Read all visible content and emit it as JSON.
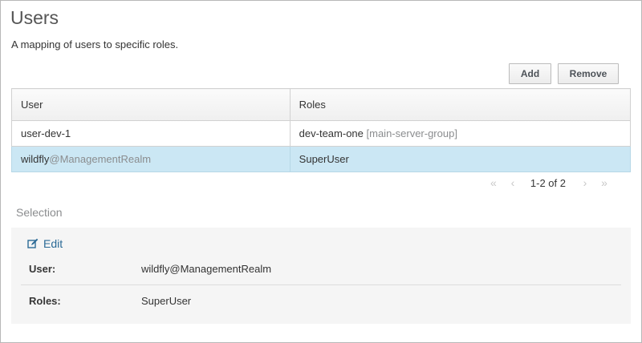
{
  "page": {
    "title": "Users",
    "description": "A mapping of users to specific roles."
  },
  "toolbar": {
    "add_label": "Add",
    "remove_label": "Remove"
  },
  "table": {
    "columns": [
      "User",
      "Roles"
    ],
    "rows": [
      {
        "user_main": "user-dev-1",
        "user_realm": "",
        "role_main": "dev-team-one",
        "role_scope": "[main-server-group]",
        "selected": false
      },
      {
        "user_main": "wildfly",
        "user_realm": "@ManagementRealm",
        "role_main": "SuperUser",
        "role_scope": "",
        "selected": true
      }
    ]
  },
  "pager": {
    "info": "1-2 of 2",
    "first_icon": "double-chevron-left-icon",
    "prev_icon": "chevron-left-icon",
    "next_icon": "chevron-right-icon",
    "last_icon": "double-chevron-right-icon"
  },
  "selection": {
    "title": "Selection",
    "edit_label": "Edit",
    "edit_icon": "edit-icon",
    "attributes": [
      {
        "label": "User:",
        "value": "wildfly@ManagementRealm"
      },
      {
        "label": "Roles:",
        "value": "SuperUser"
      }
    ]
  },
  "colors": {
    "selected_row": "#cbe7f4",
    "link": "#2b6a96",
    "muted_text": "#8b8d8f"
  }
}
